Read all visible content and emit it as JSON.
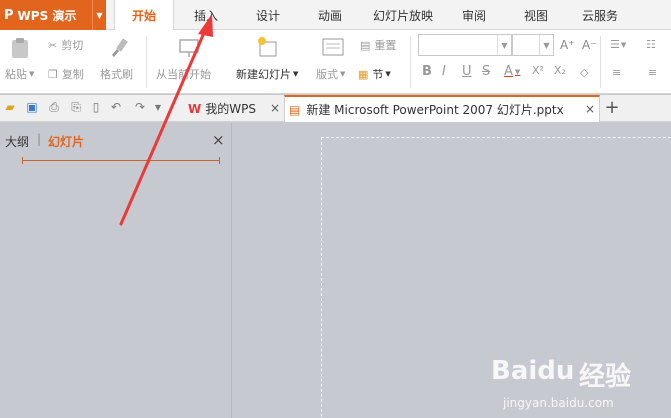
{
  "menubar": {
    "logo": "P",
    "app_name": "WPS 演示",
    "tabs": [
      "开始",
      "插入",
      "设计",
      "动画",
      "幻灯片放映",
      "审阅",
      "视图",
      "云服务"
    ],
    "active_tab": "开始"
  },
  "ribbon": {
    "paste": "粘贴",
    "cut": "剪切",
    "copy": "复制",
    "format_painter": "格式刷",
    "from_current": "从当前开始",
    "new_slide": "新建幻灯片",
    "layout": "版式",
    "reset": "重置",
    "section": "节",
    "font_name": "",
    "font_size": "",
    "bold": "B",
    "italic": "I",
    "underline": "U",
    "strike": "S",
    "font_color": "A",
    "superscript": "X²",
    "subscript": "X₂",
    "grow_font": "A⁺",
    "shrink_font": "A⁻"
  },
  "docbar": {
    "tabs": [
      {
        "label": "我的WPS",
        "active": false
      },
      {
        "label": "新建 Microsoft PowerPoint 2007 幻灯片.pptx",
        "active": true
      }
    ],
    "new_tab": "+"
  },
  "leftpanel": {
    "outline_tab": "大纲",
    "slides_tab": "幻灯片",
    "close": "×"
  },
  "watermark": {
    "brand": "Baidu",
    "cn": "经验",
    "url": "jingyan.baidu.com"
  },
  "colors": {
    "accent": "#e2651d",
    "arrow": "#ec3a3a",
    "background": "#c6c9d0"
  }
}
